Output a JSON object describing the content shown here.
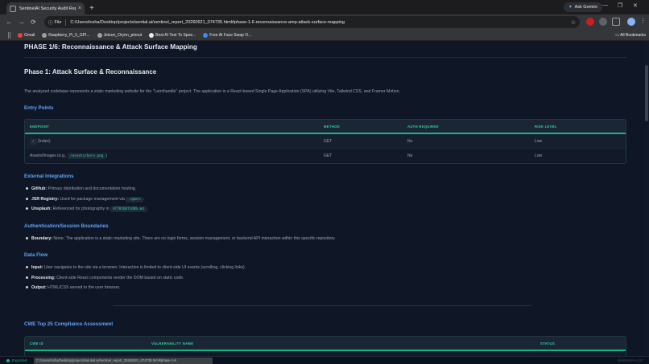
{
  "browser": {
    "tab_title": "SentinelAI Security Audit Repo",
    "tab_close": "×",
    "new_tab": "+",
    "ask_gemini": "Ask Gemini",
    "window_controls": [
      "—",
      "❐",
      "✕"
    ],
    "nav": [
      "←",
      "→",
      "⟳"
    ],
    "file_chip": "File",
    "url": "C:/Users/insha/Desktop/projects/sential.ai/sentinel_report_20260621_074735.html#phase-1-6-reconnaissance-amp-attack-surface-mapping",
    "bookmarks": [
      {
        "label": "Gmail",
        "color": "#ea4335"
      },
      {
        "label": "Raspberry_Pi_5_GPI...",
        "color": "#9aa0a6"
      },
      {
        "label": "Jetson_Orynn_pinout",
        "color": "#9aa0a6"
      },
      {
        "label": "Best AI Text To Spee...",
        "color": "#e8eaed"
      },
      {
        "label": "Free AI Face Swap O...",
        "color": "#4285f4"
      }
    ],
    "all_bookmarks": "All Bookmarks"
  },
  "report": {
    "phase_title": "PHASE 1/6: Reconnaissance & Attack Surface Mapping",
    "section_title": "Phase 1: Attack Surface & Reconnaissance",
    "intro": "The analyzed codebase represents a static marketing website for the \"Lemihandle\" project. The application is a React-based Single Page Application (SPA) utilizing Vite, Tailwind CSS, and Framer Motion.",
    "entry_points": {
      "heading": "Entry Points",
      "columns": [
        "ENDPOINT",
        "METHOD",
        "AUTH REQUIRED",
        "RISK LEVEL"
      ],
      "rows": [
        {
          "code": "/",
          "text": " (Index)",
          "method": "GET",
          "auth": "No",
          "risk": "Low"
        },
        {
          "text": "Assets/Images (e.g., ",
          "code": "/assets/hero.png",
          "suffix": ")",
          "method": "GET",
          "auth": "No",
          "risk": "Low"
        }
      ]
    },
    "external": {
      "heading": "External Integrations",
      "items": [
        {
          "label": "GitHub:",
          "text": " Primary distribution and documentation hosting."
        },
        {
          "label": "JSR Registry:",
          "text": " Used for package management via ",
          "code": ".npmrc",
          "suffix": "."
        },
        {
          "label": "Unsplash:",
          "text": " Referenced for photography in ",
          "code": "ATTRIBUTIONS.md",
          "suffix": "."
        }
      ]
    },
    "auth": {
      "heading": "Authentication/Session Boundaries",
      "items": [
        {
          "label": "Boundary:",
          "text": " None. The application is a static marketing site. There are no login forms, session management, or backend API interaction within this specific repository."
        }
      ]
    },
    "dataflow": {
      "heading": "Data Flow",
      "items": [
        {
          "label": "Input:",
          "text": " User navigates to the site via a browser. Interaction is limited to client-side UI events (scrolling, clicking links)."
        },
        {
          "label": "Processing:",
          "text": " Client-side React components render the DOM based on static code."
        },
        {
          "label": "Output:",
          "text": " HTML/CSS served to the user browser."
        }
      ]
    },
    "cwe": {
      "heading": "CWE Top 25 Compliance Assessment",
      "columns": [
        "CWE ID",
        "VULNERABILITY NAME",
        "STATUS"
      ]
    }
  },
  "footer": {
    "status": "Exported",
    "hover_url": "C:/Users/insha/Desktop/projects/sential.ai/sentinel_report_20260621_074735.html#phase-1-6",
    "version": "SentinelAI v1.0"
  },
  "colors": {
    "accent_blue": "#60a5fa",
    "accent_green": "#34d399",
    "background": "#0f1626"
  }
}
